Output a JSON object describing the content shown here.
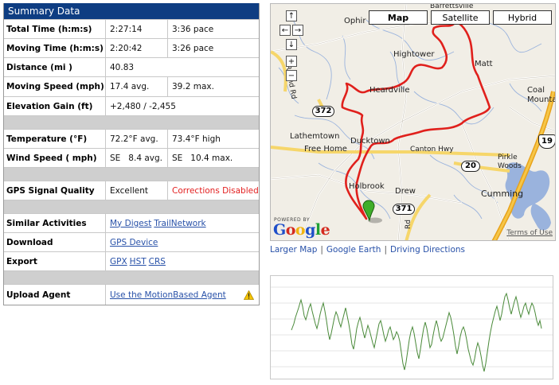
{
  "summary": {
    "title": "Summary Data",
    "total_time": {
      "label": "Total Time (h:m:s)",
      "value": "2:27:14",
      "pace": "3:36 pace"
    },
    "moving_time": {
      "label": "Moving Time (h:m:s)",
      "value": "2:20:42",
      "pace": "3:26 pace"
    },
    "distance": {
      "label": "Distance (mi )",
      "value": "40.83"
    },
    "moving_speed": {
      "label": "Moving Speed (mph)",
      "avg": "17.4 avg.",
      "max": "39.2 max."
    },
    "elevation_gain": {
      "label": "Elevation Gain (ft)",
      "value": "+2,480 / -2,455"
    },
    "temperature": {
      "label": "Temperature (°F)",
      "avg": "72.2°F avg.",
      "high": "73.4°F high"
    },
    "wind_speed": {
      "label": "Wind Speed ( mph)",
      "avg": "SE   8.4 avg.",
      "max": "SE   10.4 max."
    },
    "gps": {
      "label": "GPS Signal Quality",
      "value": "Excellent",
      "status": "Corrections Disabled"
    },
    "similar": {
      "label": "Similar Activities",
      "link1": "My Digest",
      "link2": "TrailNetwork"
    },
    "download": {
      "label": "Download",
      "link1": "GPS Device"
    },
    "export": {
      "label": "Export",
      "link1": "GPX",
      "link2": "HST",
      "link3": "CRS"
    },
    "upload": {
      "label": "Upload Agent",
      "link1": "Use the MotionBased Agent",
      "icon": "warning-icon"
    }
  },
  "map": {
    "buttons": {
      "map": "Map",
      "satellite": "Satellite",
      "hybrid": "Hybrid"
    },
    "nav": {
      "up": "↑",
      "left": "←",
      "right": "→",
      "down": "↓",
      "zoom_in": "+",
      "zoom_out": "−"
    },
    "places": {
      "barrettsville": "Barrettsville",
      "ophir": "Ophir",
      "hightower": "Hightower",
      "matt": "Matt",
      "heardville": "Heardville",
      "coal_mountain": "Coal\nMountain",
      "lathemtown": "Lathemtown",
      "free_home": "Free Home",
      "ducktown": "Ducktown",
      "canton_hwy": "Canton Hwy",
      "pirkle_woods": "Pirkle\nWoods",
      "holbrook": "Holbrook",
      "drew": "Drew",
      "cumming": "Cumming",
      "round_rd": "Round Rd",
      "rd": "Rd"
    },
    "shields": {
      "r372": "372",
      "r20": "20",
      "r19": "19",
      "r371": "371"
    },
    "powered_by": "POWERED BY",
    "google": "Google",
    "terms": "Terms of Use"
  },
  "map_links": {
    "larger": "Larger Map",
    "earth": "Google Earth",
    "directions": "Driving Directions",
    "sep": "|"
  },
  "colors": {
    "header_bg": "#0e3d82",
    "link": "#2851a8",
    "route": "#e0201c",
    "status_red": "#e32020",
    "chart_line": "#4a8a3a",
    "highway": "#f4b400"
  }
}
